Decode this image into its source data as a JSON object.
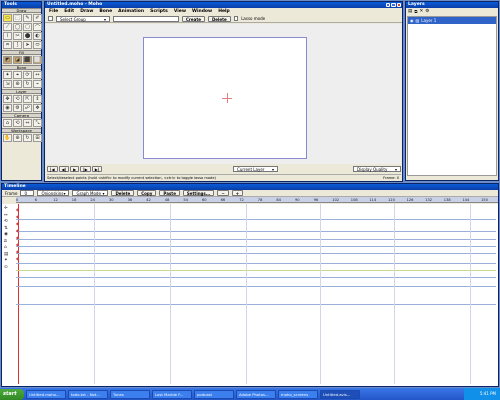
{
  "tools_panel": {
    "title": "Tools",
    "sections": [
      {
        "label": "Draw",
        "tools": [
          "▭",
          "⬚",
          "✎",
          "✐",
          "⟋",
          "◯",
          "▢",
          "⌒",
          "⌇",
          "✂",
          "⬤",
          "◐",
          "⌗",
          "⟆",
          "➤",
          "⬭"
        ]
      },
      {
        "label": "Fill",
        "tools": [
          "◩",
          "◪",
          "⬛",
          "⬜"
        ]
      },
      {
        "label": "Bone",
        "tools": [
          "✦",
          "⌖",
          "⟳",
          "↔",
          "⇲",
          "⊕",
          "↻",
          "⌁"
        ]
      },
      {
        "label": "Layer",
        "tools": [
          "✥",
          "⟲",
          "⇱",
          "⇕",
          "◉",
          "⚙",
          "☍",
          "❖"
        ]
      },
      {
        "label": "Camera",
        "tools": [
          "⌂",
          "⟲",
          "⇔",
          "⤡"
        ]
      },
      {
        "label": "Workspace",
        "tools": [
          "✋",
          "⊕",
          "↻",
          "⊞"
        ]
      }
    ]
  },
  "main_window": {
    "title": "Untitled.moho - Moho",
    "menu": [
      "File",
      "Edit",
      "Draw",
      "Bone",
      "Animation",
      "Scripts",
      "View",
      "Window",
      "Help"
    ],
    "toolbar": {
      "select_group": "Select Group",
      "create_label": "Create",
      "delete_label": "Delete",
      "lasso_label": "Lasso mode"
    },
    "bottom": {
      "current_layer": "Current Layer",
      "display_quality": "Display Quality",
      "status_text": "Select/deselect points (hold <shift> to modify current selection, <ctrl> to toggle lasso mode)",
      "frame_readout": "Frame: 0"
    }
  },
  "layers_panel": {
    "title": "Layers",
    "layer_name": "Layer 1"
  },
  "timeline": {
    "title": "Timeline",
    "frame_label": "Frame",
    "frame_value": "0",
    "onionskins": "Onionskins",
    "graph_mode": "Graph Mode",
    "buttons": [
      "Delete",
      "Copy",
      "Paste",
      "Settings..."
    ],
    "ruler": [
      "0",
      "6",
      "12",
      "18",
      "24",
      "30",
      "36",
      "42",
      "48",
      "54",
      "60",
      "66",
      "72",
      "78",
      "84",
      "90",
      "96",
      "102",
      "108",
      "114",
      "120",
      "126",
      "132",
      "138",
      "144",
      "150"
    ]
  },
  "taskbar": {
    "start": "start",
    "tasks": [
      "Untitled.moho...",
      "todo.txt - Not...",
      "Tunes",
      "Lost Marble F...",
      "podcast",
      "Adobe Photos...",
      "moho_screens",
      "Untitled.avis..."
    ],
    "clock": "5:41 PM"
  }
}
